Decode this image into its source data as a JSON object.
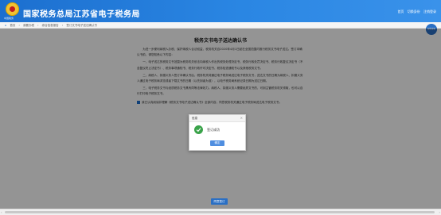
{
  "header": {
    "site_title": "国家税务总局江苏省电子税务局",
    "logo_caption": "中国税务",
    "links": [
      "首页",
      "切换身份",
      "注销登录"
    ]
  },
  "breadcrumb": {
    "items": [
      "首页",
      "我要办税",
      "综合信息报告",
      "签订文书电子送达确认书"
    ]
  },
  "side_badge": "智能客服",
  "document": {
    "title": "税务文书电子送达确认书",
    "paragraphs": [
      "为进一步便利纳税人办税，保护纳税人合法权益，税务机关自2020年4月1日起在全国范围内推行税务文书电子送达。签订本确认书前，请您知悉以下内容：",
      "一、电子送达的税务文书范围为税务机关依法向纳税人作出的税务处理决定书、税务行政处罚决定书、税务行政复议决定书（不含复议终止决定书）、税务事项通知书、税务行政许可决定书、税务检查通知书以及其他税务文书。",
      "二、纳税人、扣缴义务人签订本确认书后，税务机关将通过电子税务局送达电子税务文书，送达文书的日期为纳税人、扣缴义务人通过电子税务局浏览或者下载文书的日期（以先到者为准），以电子税务局系统记录日期为送达日期。",
      "三、电子税务文书与纸质税务文书具有同等法律效力。纳税人、扣缴义务人需要纸质文书的，可到主管税务机关领取，也可以自行打印电子税务文书。"
    ],
    "agree_text": "我已认真阅读并理解《税务文书电子送达确认书》全部内容，同意税务机关通过电子税务局送达电子税务文书。"
  },
  "submit_label": "同意签订",
  "dialog": {
    "title": "信息",
    "message": "签订成功",
    "ok_label": "确定"
  }
}
